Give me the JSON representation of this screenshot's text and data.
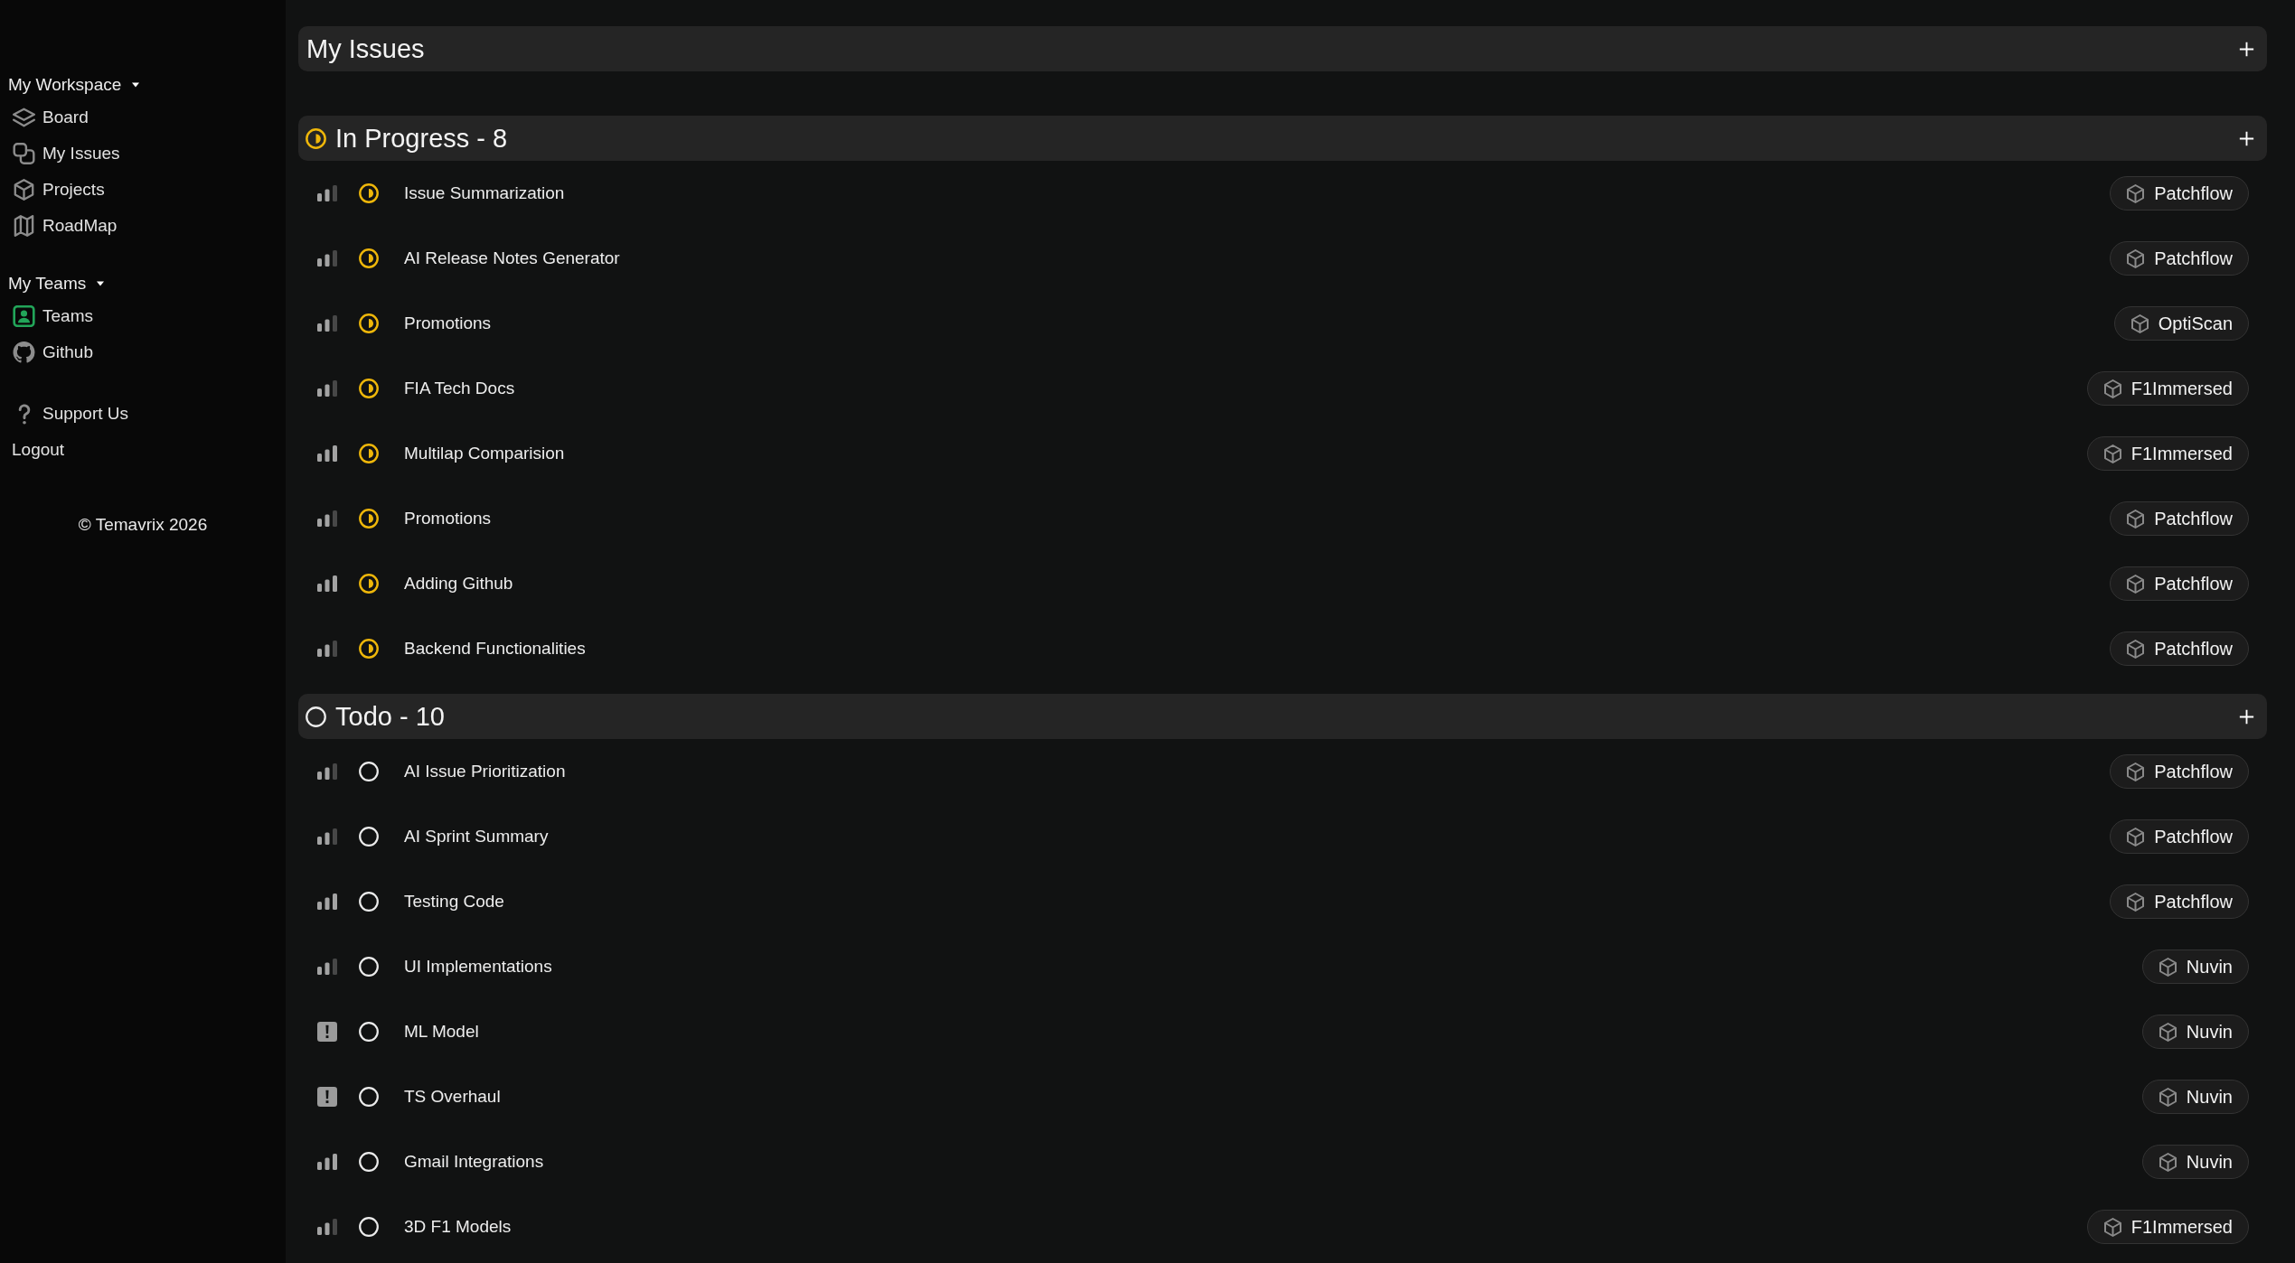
{
  "sidebar": {
    "sections": [
      {
        "title": "My Workspace",
        "expanded": true,
        "items": [
          {
            "kind": "board",
            "label": "Board"
          },
          {
            "kind": "issues",
            "label": "My Issues"
          },
          {
            "kind": "projects",
            "label": "Projects"
          },
          {
            "kind": "roadmap",
            "label": "RoadMap"
          }
        ]
      },
      {
        "title": "My Teams",
        "expanded": true,
        "items": [
          {
            "kind": "teams",
            "label": "Teams"
          },
          {
            "kind": "github",
            "label": "Github"
          }
        ]
      }
    ],
    "links": [
      {
        "kind": "support",
        "label": "Support Us"
      },
      {
        "kind": "logout",
        "label": "Logout"
      }
    ],
    "copyright": "© Temavrix 2026"
  },
  "page_header": {
    "title": "My Issues"
  },
  "groups": [
    {
      "kind": "progress",
      "title": "In Progress - 8",
      "issues": [
        {
          "kind": "medium",
          "title": "Issue Summarization",
          "project": "Patchflow"
        },
        {
          "kind": "medium",
          "title": "AI Release Notes Generator",
          "project": "Patchflow"
        },
        {
          "kind": "medium",
          "title": "Promotions",
          "project": "OptiScan"
        },
        {
          "kind": "medium",
          "title": "FIA Tech Docs",
          "project": "F1Immersed"
        },
        {
          "kind": "high",
          "title": "Multilap Comparision",
          "project": "F1Immersed"
        },
        {
          "kind": "medium",
          "title": "Promotions",
          "project": "Patchflow"
        },
        {
          "kind": "high",
          "title": "Adding Github",
          "project": "Patchflow"
        },
        {
          "kind": "medium",
          "title": "Backend Functionalities",
          "project": "Patchflow"
        }
      ]
    },
    {
      "kind": "todo",
      "title": "Todo - 10",
      "issues": [
        {
          "kind": "medium",
          "title": "AI Issue Prioritization",
          "project": "Patchflow"
        },
        {
          "kind": "medium",
          "title": "AI Sprint Summary",
          "project": "Patchflow"
        },
        {
          "kind": "high",
          "title": "Testing Code",
          "project": "Patchflow"
        },
        {
          "kind": "medium",
          "title": "UI Implementations",
          "project": "Nuvin"
        },
        {
          "kind": "urgent",
          "title": "ML Model",
          "project": "Nuvin"
        },
        {
          "kind": "urgent",
          "title": "TS Overhaul",
          "project": "Nuvin"
        },
        {
          "kind": "high",
          "title": "Gmail Integrations",
          "project": "Nuvin"
        },
        {
          "kind": "medium",
          "title": "3D F1 Models",
          "project": "F1Immersed"
        }
      ]
    }
  ]
}
